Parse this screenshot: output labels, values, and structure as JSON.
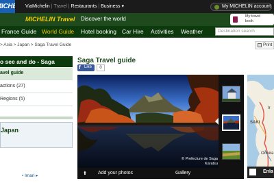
{
  "topbar": {
    "logo": "MICHELIN",
    "links": [
      "ViaMichelin",
      "Travel",
      "Restaurants",
      "Business ▾"
    ],
    "account_label": "My MICHELIN account"
  },
  "brandband": {
    "brand": "MICHELIN Travel",
    "tagline": "Discover the world",
    "mytravel_line1": "My travel",
    "mytravel_line2": "book"
  },
  "nav": {
    "items": [
      "France Guide",
      "World Guide",
      "Hotel booking",
      "Car Hire",
      "Activities",
      "Weather"
    ],
    "active_index": 1,
    "search_placeholder": "Destination search"
  },
  "breadcrumb": {
    "text": "> Asia > Japan > Saga Travel Guide",
    "print_label": "Print"
  },
  "sidebar": {
    "heading": "o see and do - Saga",
    "items": [
      {
        "label": "avel guide",
        "active": true
      },
      {
        "label": "actions (27)",
        "active": false
      },
      {
        "label": "Regions (5)",
        "active": false
      },
      {
        "label": "",
        "active": false
      }
    ],
    "japan_title": "Japan",
    "imari_link": "• Imari ▸"
  },
  "guide": {
    "title": "Saga Travel guide",
    "fb_label": "Like",
    "fb_count": "0",
    "credit_line1": "© Prefecture de Saga",
    "credit_line2": "Karatsu",
    "add_photos": "Add your photos",
    "gallery": "Gallery"
  },
  "map": {
    "labels": [
      "SAKI",
      "Omura",
      "Ir"
    ],
    "enlarge_label": "Enla"
  }
}
